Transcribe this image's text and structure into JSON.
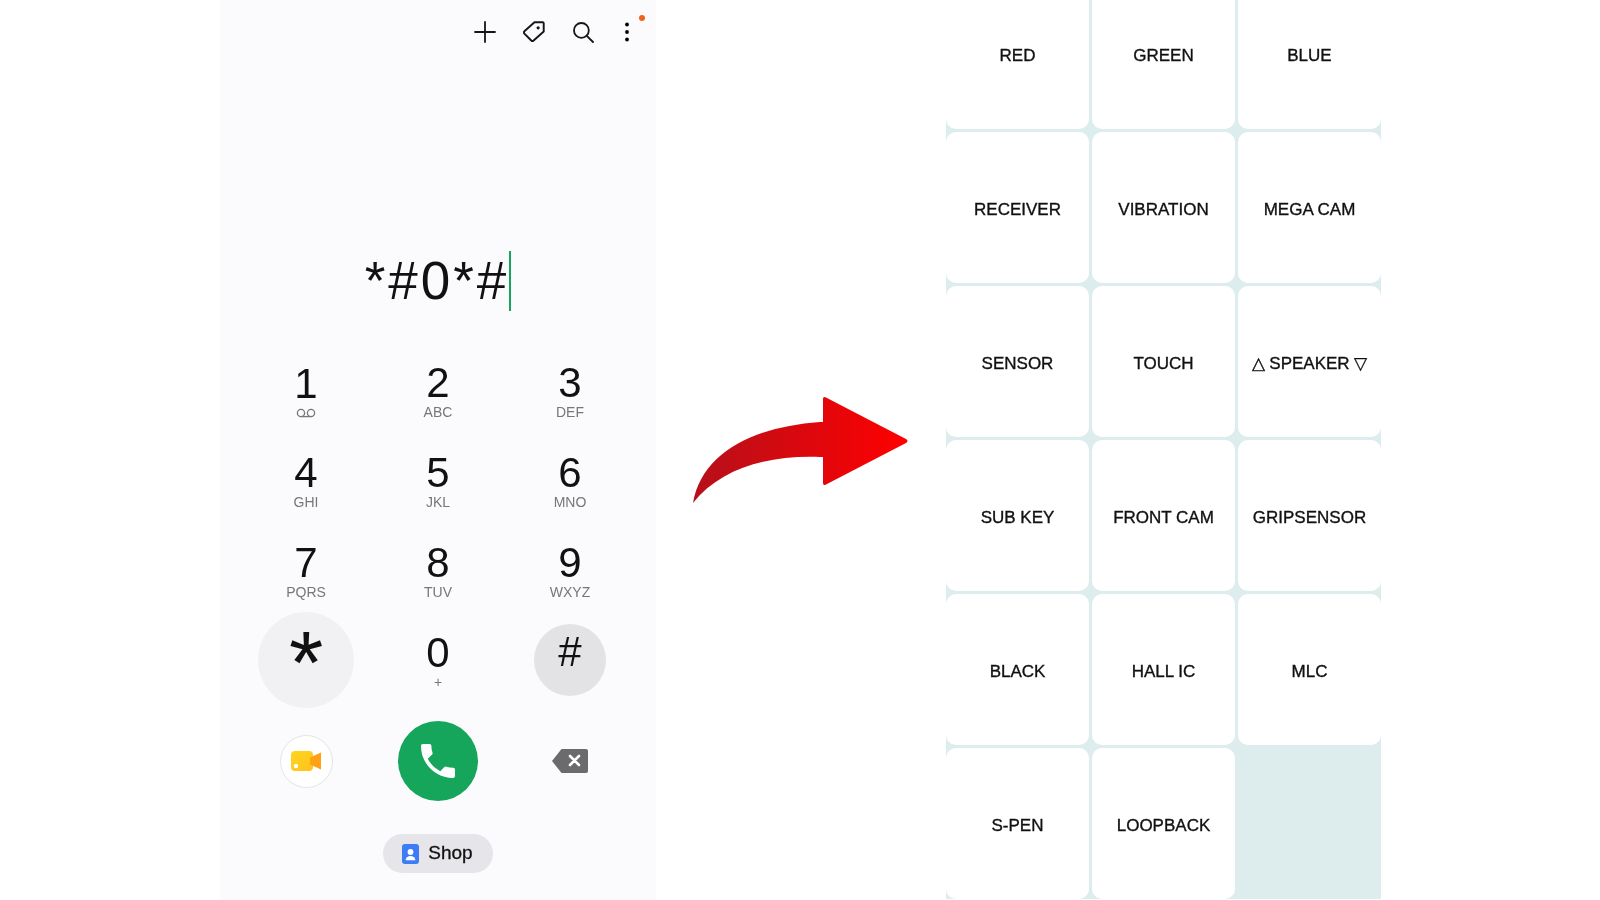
{
  "dialer": {
    "toolbar": {
      "menu_badge": true
    },
    "dialed_number": {
      "value": "*#0*#",
      "cursor": true
    },
    "keys": [
      {
        "digit": "1",
        "kind": "voicemail",
        "pressed": false,
        "ripple": false
      },
      {
        "digit": "2",
        "kind": "letters",
        "letters": "ABC",
        "pressed": false,
        "ripple": false
      },
      {
        "digit": "3",
        "kind": "letters",
        "letters": "DEF",
        "pressed": false,
        "ripple": false
      },
      {
        "digit": "4",
        "kind": "letters",
        "letters": "GHI",
        "pressed": false,
        "ripple": false
      },
      {
        "digit": "5",
        "kind": "letters",
        "letters": "JKL",
        "pressed": false,
        "ripple": false
      },
      {
        "digit": "6",
        "kind": "letters",
        "letters": "MNO",
        "pressed": false,
        "ripple": false
      },
      {
        "digit": "7",
        "kind": "letters",
        "letters": "PQRS",
        "pressed": false,
        "ripple": false
      },
      {
        "digit": "8",
        "kind": "letters",
        "letters": "TUV",
        "pressed": false,
        "ripple": false
      },
      {
        "digit": "9",
        "kind": "letters",
        "letters": "WXYZ",
        "pressed": false,
        "ripple": false
      },
      {
        "digit": "*",
        "kind": "star",
        "pressed": false,
        "ripple": true
      },
      {
        "digit": "0",
        "kind": "letters",
        "letters": "+",
        "pressed": false,
        "ripple": false
      },
      {
        "digit": "#",
        "kind": "plain",
        "pressed": true,
        "ripple": false
      }
    ],
    "shop_button": {
      "label": "Shop"
    }
  },
  "test_menu": {
    "items": [
      {
        "label": "RED"
      },
      {
        "label": "GREEN"
      },
      {
        "label": "BLUE"
      },
      {
        "label": "RECEIVER"
      },
      {
        "label": "VIBRATION"
      },
      {
        "label": "MEGA CAM"
      },
      {
        "label": "SENSOR"
      },
      {
        "label": "TOUCH"
      },
      {
        "label": "△ SPEAKER ▽"
      },
      {
        "label": "SUB KEY"
      },
      {
        "label": "FRONT CAM"
      },
      {
        "label": "GRIPSENSOR"
      },
      {
        "label": "BLACK"
      },
      {
        "label": "HALL IC"
      },
      {
        "label": "MLC"
      },
      {
        "label": "S-PEN"
      },
      {
        "label": "LOOPBACK"
      }
    ]
  }
}
